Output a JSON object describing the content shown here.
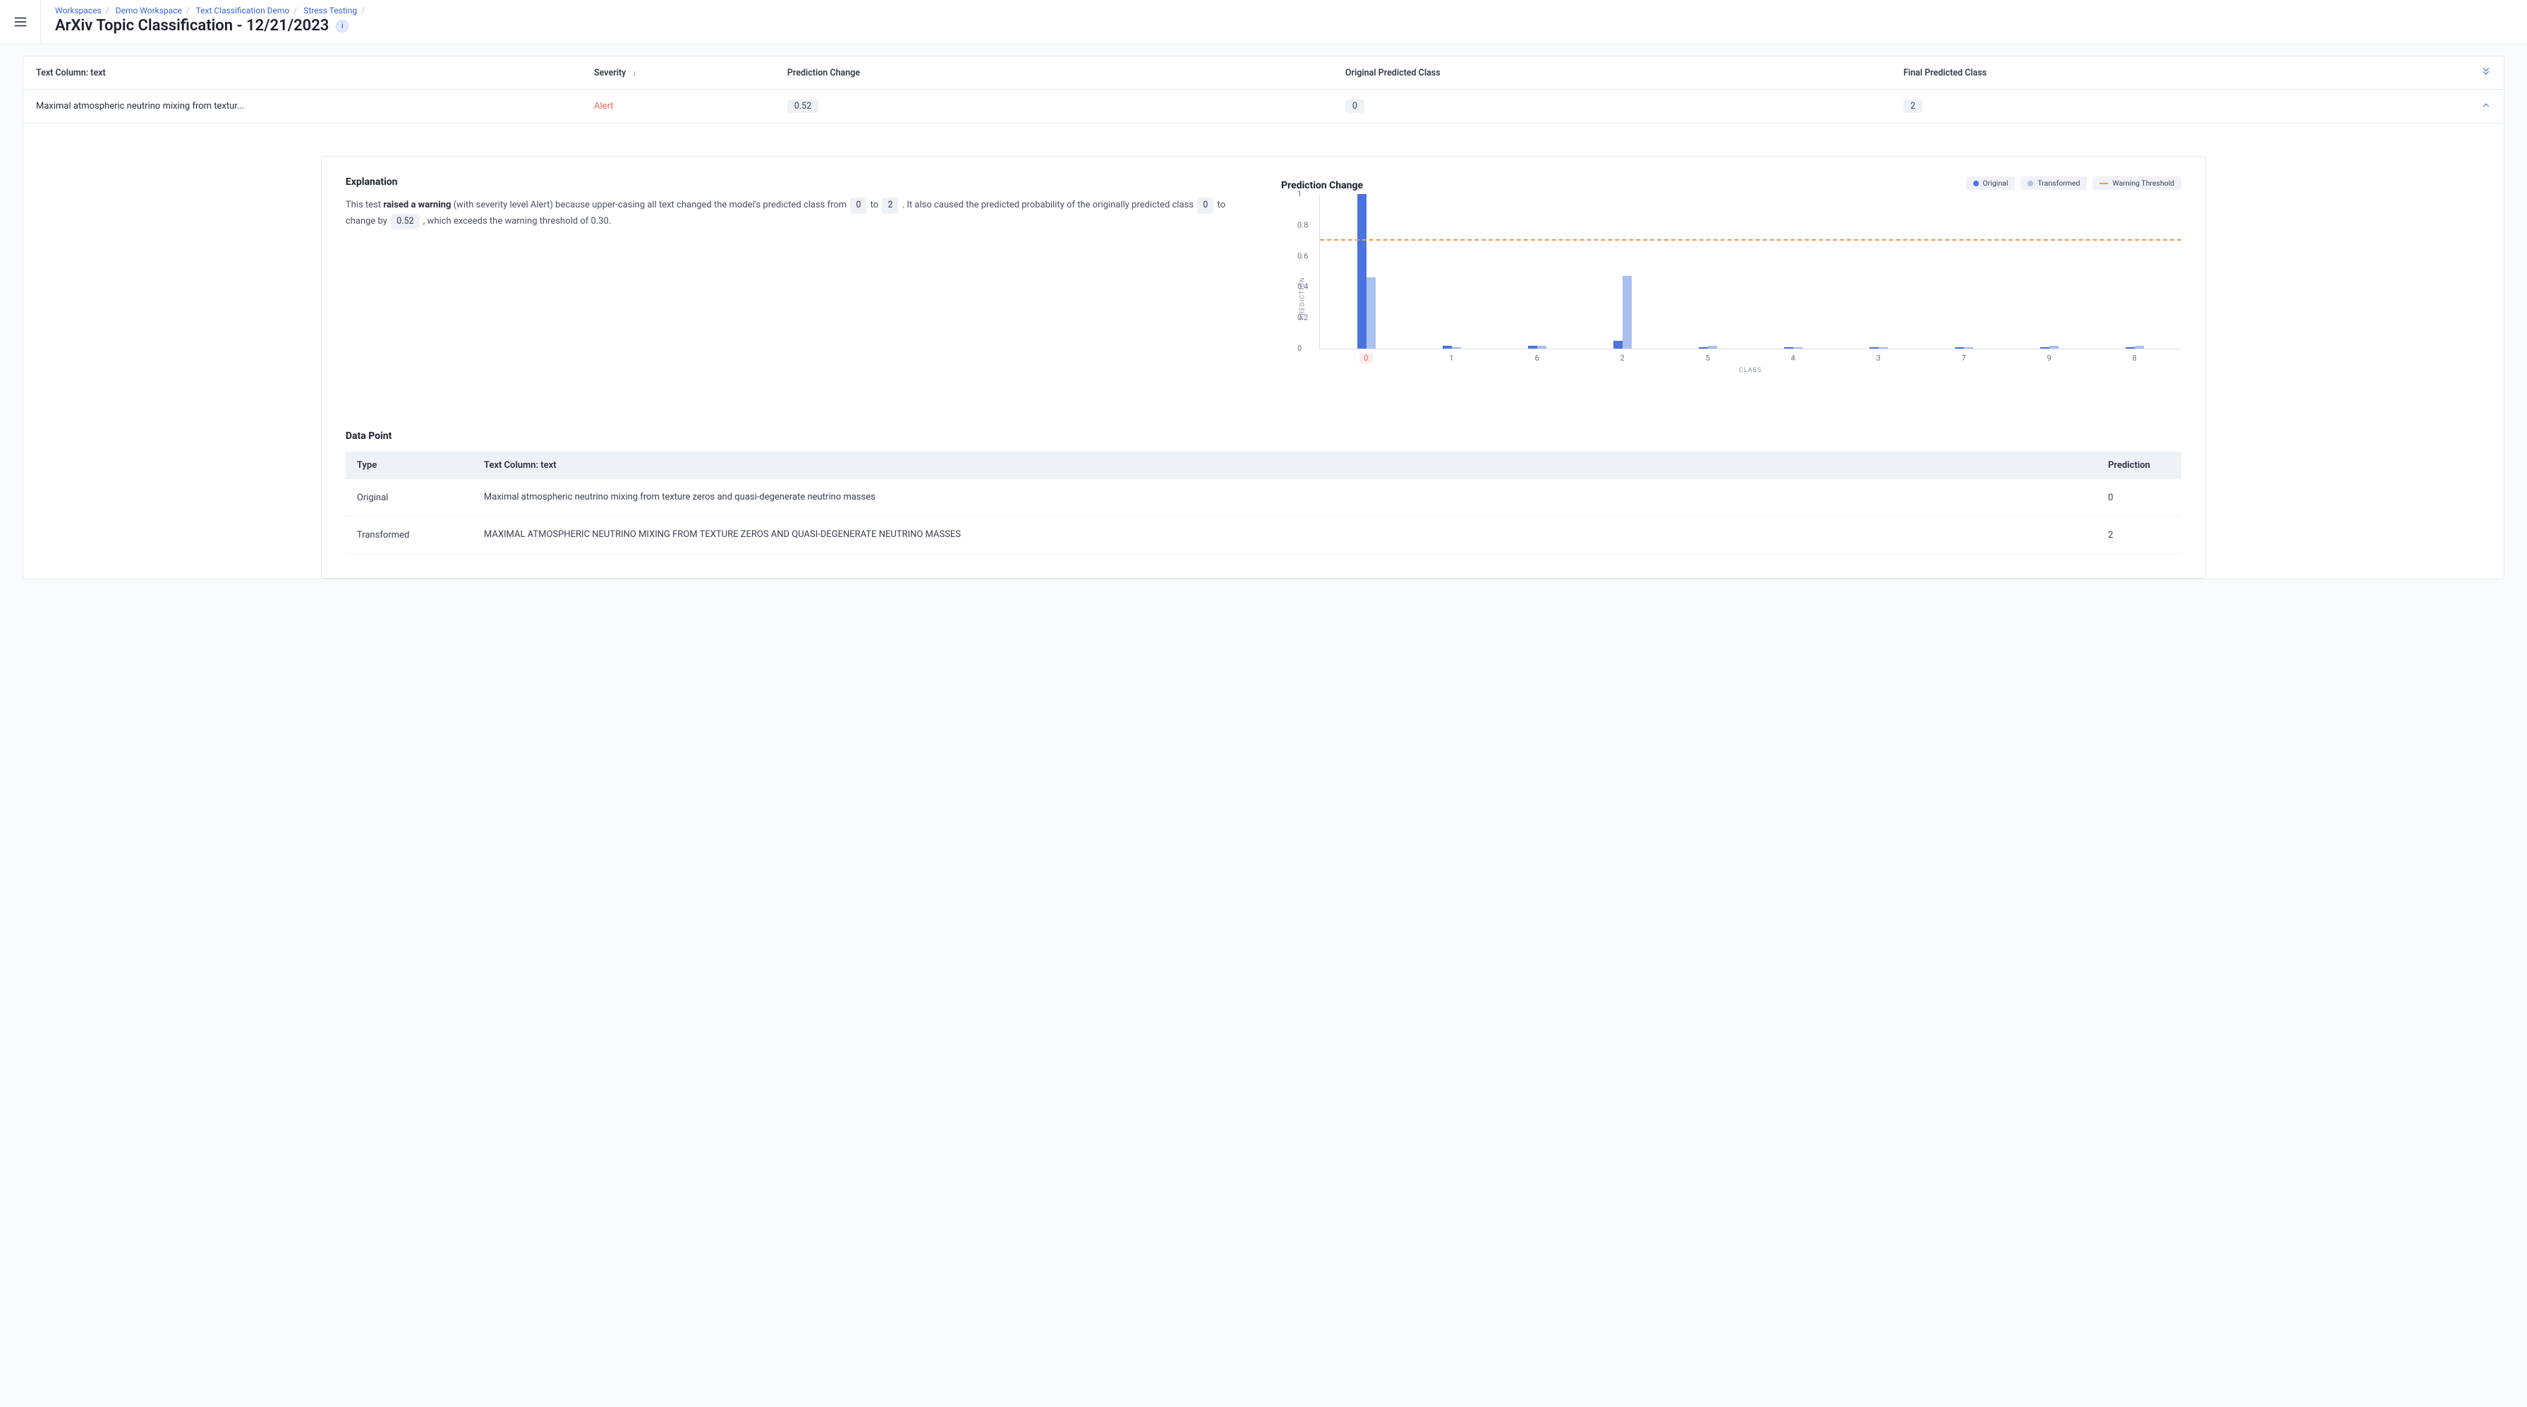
{
  "breadcrumb": [
    {
      "label": "Workspaces"
    },
    {
      "label": "Demo Workspace"
    },
    {
      "label": "Text Classification Demo"
    },
    {
      "label": "Stress Testing"
    }
  ],
  "page_title": "ArXiv Topic Classification - 12/21/2023",
  "columns": {
    "text": "Text Column: text",
    "severity": "Severity",
    "pred_change": "Prediction Change",
    "orig_class": "Original Predicted Class",
    "final_class": "Final Predicted Class"
  },
  "row": {
    "text": "Maximal atmospheric neutrino mixing from textur...",
    "severity": "Alert",
    "pred_change": "0.52",
    "orig_class": "0",
    "final_class": "2"
  },
  "explanation": {
    "heading": "Explanation",
    "pre": "This test ",
    "bold": "raised a warning",
    "seg1": " (with severity level Alert) because upper-casing all text changed the model's predicted class from ",
    "chip_from": "0",
    "seg_to": " to ",
    "chip_to": "2",
    "seg2": " . It also caused the predicted probability of the originally predicted class ",
    "chip_orig": "0",
    "seg3": " to change by ",
    "chip_delta": "0.52",
    "seg4": " , which exceeds the warning threshold of 0.30."
  },
  "chart": {
    "heading": "Prediction Change",
    "legend": {
      "original": "Original",
      "transformed": "Transformed",
      "threshold": "Warning Threshold"
    },
    "y_label": "PREDICTION",
    "x_label": "CLASS"
  },
  "chart_data": {
    "type": "bar",
    "categories": [
      "0",
      "1",
      "6",
      "2",
      "5",
      "4",
      "3",
      "7",
      "9",
      "8"
    ],
    "highlight_category": "0",
    "series": [
      {
        "name": "Original",
        "values": [
          1.0,
          0.02,
          0.02,
          0.05,
          0.01,
          0.01,
          0.01,
          0.01,
          0.01,
          0.01
        ]
      },
      {
        "name": "Transformed",
        "values": [
          0.46,
          0.01,
          0.02,
          0.47,
          0.02,
          0.01,
          0.01,
          0.01,
          0.02,
          0.02
        ]
      }
    ],
    "warning_threshold": 0.7,
    "y_ticks": [
      0,
      0.2,
      0.4,
      0.6,
      0.8,
      1
    ],
    "ylim": [
      0,
      1
    ],
    "xlabel": "CLASS",
    "ylabel": "PREDICTION",
    "title": "Prediction Change"
  },
  "datapoint": {
    "heading": "Data Point",
    "cols": {
      "type": "Type",
      "text": "Text Column: text",
      "pred": "Prediction"
    },
    "rows": [
      {
        "type": "Original",
        "text": "Maximal atmospheric neutrino mixing from texture zeros and quasi-degenerate neutrino masses",
        "pred": "0"
      },
      {
        "type": "Transformed",
        "text": "MAXIMAL ATMOSPHERIC NEUTRINO MIXING FROM TEXTURE ZEROS AND QUASI-DEGENERATE NEUTRINO MASSES",
        "pred": "2"
      }
    ]
  },
  "colors": {
    "original": "#4a73df",
    "transformed": "#a9c1f0",
    "threshold": "#e79b4f",
    "alert": "#e76a5c"
  }
}
